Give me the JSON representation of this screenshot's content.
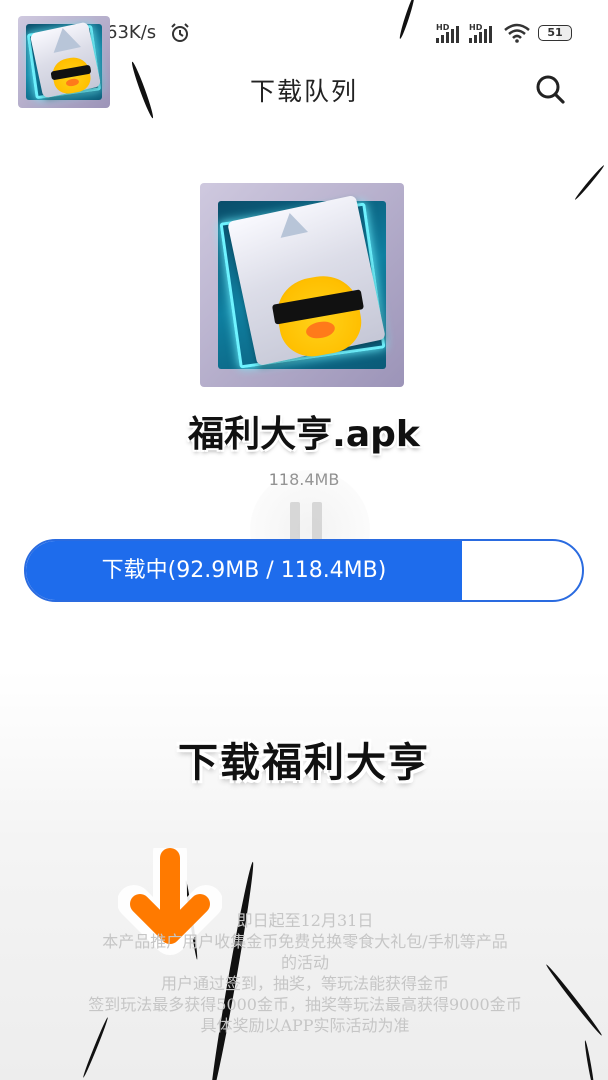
{
  "status_bar": {
    "speed": "63K/s",
    "signal1_label": "HD",
    "signal2_label": "HD",
    "battery": "51"
  },
  "header": {
    "title": "下载队列"
  },
  "file": {
    "name": "福利大亨.apk",
    "size": "118.4MB"
  },
  "download": {
    "label": "下载中(92.9MB / 118.4MB)",
    "progress_fraction": 0.785,
    "color": "#1e6cec"
  },
  "promo": {
    "title": "下载福利大亨",
    "notes": [
      "即日起至12月31日",
      "本产品推广用户收集金币免费兑换零食大礼包/手机等产品",
      "的活动",
      "用户通过签到，抽奖，等玩法能获得金币",
      "签到玩法最多获得5000金币，抽奖等玩法最高获得9000金币",
      "具体奖励以APP实际活动为准"
    ]
  }
}
